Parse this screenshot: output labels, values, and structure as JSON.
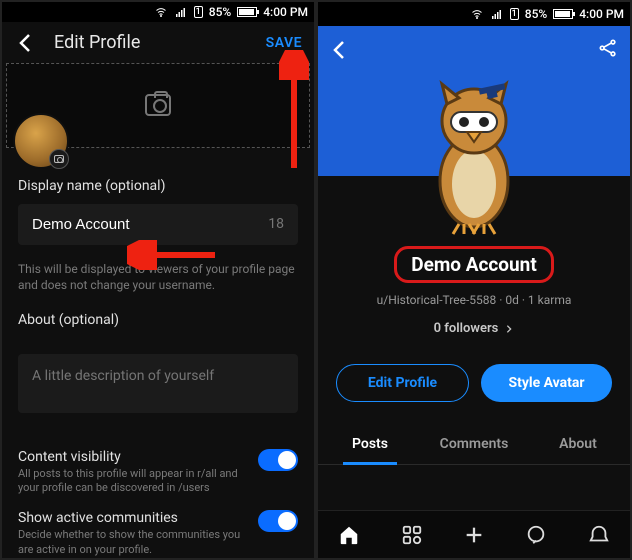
{
  "status": {
    "battery_pct": "85%",
    "time": "4:00 PM"
  },
  "left": {
    "header": {
      "title": "Edit Profile",
      "save": "SAVE"
    },
    "display_name": {
      "label": "Display name (optional)",
      "value": "Demo Account",
      "remaining": "18",
      "hint": "This will be displayed to viewers of your profile page and does not change your username."
    },
    "about": {
      "label": "About (optional)",
      "placeholder": "A little description of yourself"
    },
    "content_visibility": {
      "title": "Content visibility",
      "desc": "All posts to this profile will appear in r/all and your profile can be discovered in /users",
      "on": true
    },
    "active_communities": {
      "title": "Show active communities",
      "desc": "Decide whether to show the communities you are active in on your profile.",
      "on": true
    }
  },
  "right": {
    "display_name": "Demo Account",
    "user_line": "u/Historical-Tree-5588 · 0d · 1 karma",
    "followers": "0 followers",
    "buttons": {
      "edit": "Edit Profile",
      "style": "Style Avatar"
    },
    "tabs": {
      "posts": "Posts",
      "comments": "Comments",
      "about": "About"
    }
  }
}
